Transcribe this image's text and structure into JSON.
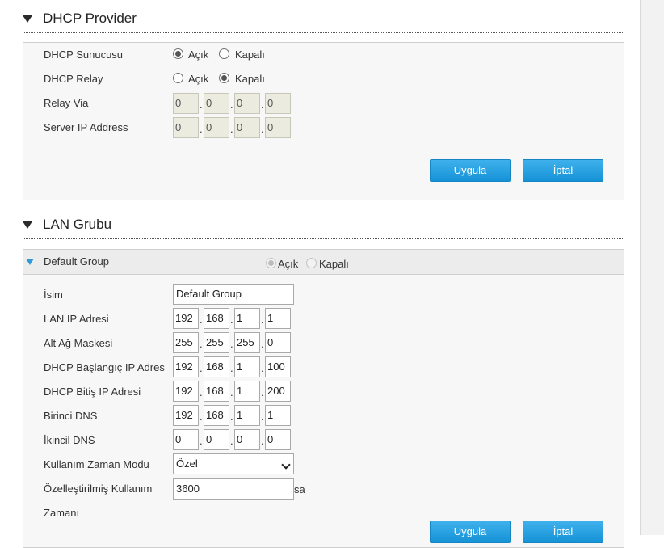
{
  "dhcp_provider": {
    "title": "DHCP Provider",
    "dhcp_server": {
      "label": "DHCP Sunucusu",
      "on_label": "Açık",
      "off_label": "Kapalı",
      "selected": "on"
    },
    "dhcp_relay": {
      "label": "DHCP Relay",
      "on_label": "Açık",
      "off_label": "Kapalı",
      "selected": "off"
    },
    "relay_via": {
      "label": "Relay Via",
      "octets": [
        "0",
        "0",
        "0",
        "0"
      ]
    },
    "server_ip": {
      "label": "Server IP Address",
      "octets": [
        "0",
        "0",
        "0",
        "0"
      ]
    },
    "apply_label": "Uygula",
    "cancel_label": "İptal"
  },
  "lan_group": {
    "title": "LAN Grubu",
    "group": {
      "name": "Default Group",
      "on_label": "Açık",
      "off_label": "Kapalı",
      "selected": "on",
      "fields": {
        "name": {
          "label": "İsim",
          "value": "Default Group"
        },
        "lan_ip": {
          "label": "LAN IP Adresi",
          "octets": [
            "192",
            "168",
            "1",
            "1"
          ]
        },
        "subnet": {
          "label": "Alt Ağ Maskesi",
          "octets": [
            "255",
            "255",
            "255",
            "0"
          ]
        },
        "dhcp_start": {
          "label": "DHCP Başlangıç IP Adres",
          "octets": [
            "192",
            "168",
            "1",
            "100"
          ]
        },
        "dhcp_end": {
          "label": "DHCP Bitiş IP Adresi",
          "octets": [
            "192",
            "168",
            "1",
            "200"
          ]
        },
        "dns1": {
          "label": "Birinci DNS",
          "octets": [
            "192",
            "168",
            "1",
            "1"
          ]
        },
        "dns2": {
          "label": "İkincil DNS",
          "octets": [
            "0",
            "0",
            "0",
            "0"
          ]
        },
        "lease_mode": {
          "label": "Kullanım Zaman Modu",
          "value": "Özel"
        },
        "custom_lease": {
          "label_line1": "Özelleştirilmiş Kullanım",
          "label_line2": "Zamanı",
          "value": "3600",
          "unit": "sa"
        }
      }
    },
    "apply_label": "Uygula",
    "cancel_label": "İptal"
  }
}
